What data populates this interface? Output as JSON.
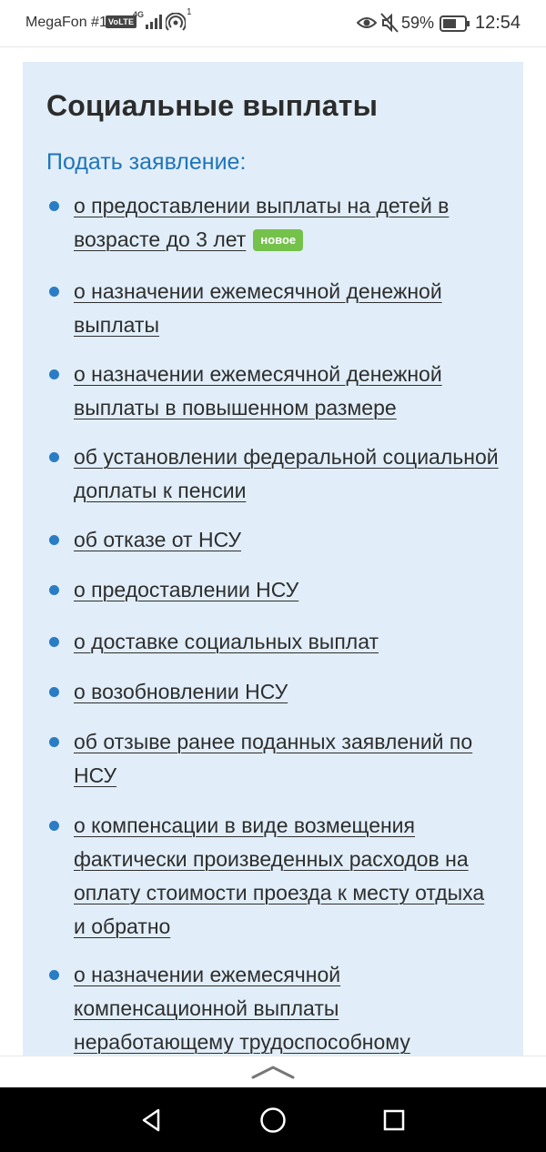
{
  "status_bar": {
    "carrier": "MegaFon #1",
    "volte": "VoLTE",
    "network": "4G",
    "hotspot_count": "1",
    "battery": "59%",
    "time": "12:54"
  },
  "section": {
    "title": "Социальные выплаты",
    "subtitle": "Подать заявление:",
    "items": [
      {
        "label": "о предоставлении выплаты на детей в возрасте до 3 лет",
        "badge": "новое"
      },
      {
        "label": "о назначении ежемесячной денежной выплаты"
      },
      {
        "label": "о назначении ежемесячной денежной выплаты в повышенном размере"
      },
      {
        "label": "об установлении федеральной социальной доплаты к пенсии"
      },
      {
        "label": "об отказе от НСУ"
      },
      {
        "label": "о предоставлении НСУ"
      },
      {
        "label": "о доставке социальных выплат"
      },
      {
        "label": "о возобновлении НСУ"
      },
      {
        "label": "об отзыве ранее поданных заявлений по НСУ"
      },
      {
        "label": "о компенсации в виде возмещения фактически произведенных расходов на оплату стоимости проезда к месту отдыха и обратно"
      },
      {
        "label": "о назначении ежемесячной компенсационной выплаты неработающему трудоспособному"
      }
    ]
  },
  "icons": {
    "bullet_color": "#2a7cc4",
    "badge_color": "#74c14b",
    "panel_color": "#e1eef9",
    "sheet_handle": "chevron-up-icon",
    "nav": [
      "back-triangle-icon",
      "home-circle-icon",
      "recent-square-icon"
    ]
  }
}
